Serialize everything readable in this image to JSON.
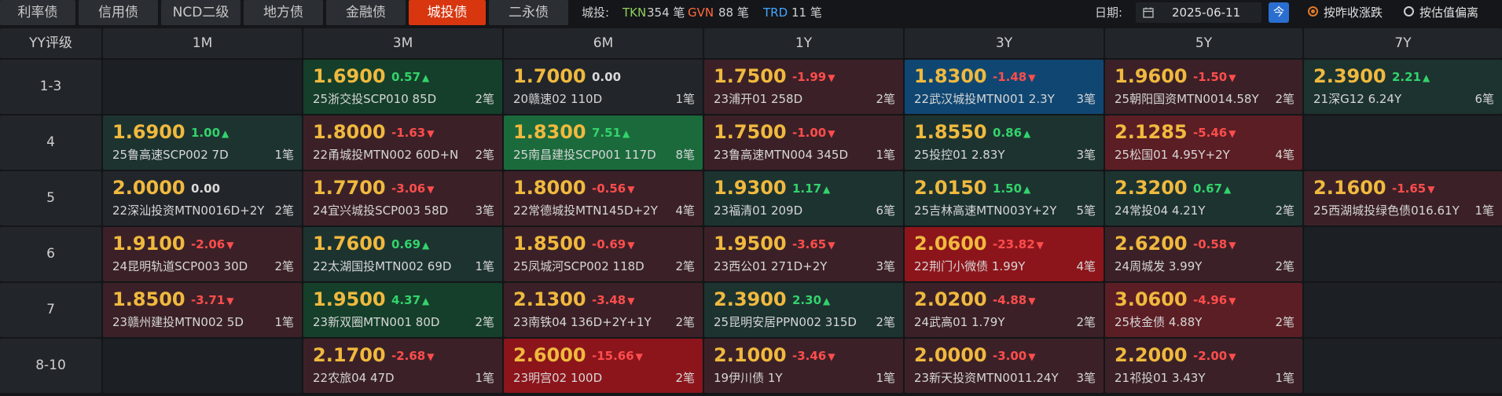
{
  "tabs": [
    {
      "label": "利率债",
      "active": false
    },
    {
      "label": "信用债",
      "active": false
    },
    {
      "label": "NCD二级",
      "active": false
    },
    {
      "label": "地方债",
      "active": false
    },
    {
      "label": "金融债",
      "active": false
    },
    {
      "label": "城投债",
      "active": true
    },
    {
      "label": "二永债",
      "active": false
    }
  ],
  "stats": {
    "category_label": "城投:",
    "tkn_label": "TKN",
    "tkn_count": "354 笔",
    "gvn_label": "GVN",
    "gvn_count": "88 笔",
    "trd_label": "TRD",
    "trd_count": "11 笔"
  },
  "date": {
    "label": "日期:",
    "value": "2025-06-11",
    "today_label": "今"
  },
  "sort": {
    "option1": "按昨收涨跌",
    "option2": "按估值偏离",
    "selected": "option1"
  },
  "colors": {
    "accent": "#d8360f",
    "rate": "#f0b93e",
    "up": "#33d36c",
    "down": "#ff4d4d",
    "tkn": "#8fd05e",
    "gvn": "#ff6a3d",
    "trd": "#46a6ff"
  },
  "grid": {
    "corner_label": "YY评级",
    "columns": [
      "1M",
      "3M",
      "6M",
      "1Y",
      "3Y",
      "5Y",
      "7Y"
    ],
    "rows": [
      {
        "label": "1-3",
        "cells": [
          null,
          {
            "rate": "1.6900",
            "change": "0.57",
            "dir": "up",
            "bond": "25浙交投SCP010 85D",
            "count": "2笔",
            "bg": "g2"
          },
          {
            "rate": "1.7000",
            "change": "0.00",
            "dir": "flat",
            "bond": "20赣速02 110D",
            "count": "1笔",
            "bg": "n"
          },
          {
            "rate": "1.7500",
            "change": "-1.99",
            "dir": "down",
            "bond": "23浦开01 258D",
            "count": "2笔",
            "bg": "r1"
          },
          {
            "rate": "1.8300",
            "change": "-1.48",
            "dir": "down",
            "bond": "22武汉城投MTN001 2.3Y",
            "count": "3笔",
            "bg": "b"
          },
          {
            "rate": "1.9600",
            "change": "-1.50",
            "dir": "down",
            "bond": "25朝阳国资MTN0014.58Y",
            "count": "2笔",
            "bg": "r1"
          },
          {
            "rate": "2.3900",
            "change": "2.21",
            "dir": "up",
            "bond": "21深G12 6.24Y",
            "count": "6笔",
            "bg": "g1"
          }
        ]
      },
      {
        "label": "4",
        "cells": [
          {
            "rate": "1.6900",
            "change": "1.00",
            "dir": "up",
            "bond": "25鲁高速SCP002 7D",
            "count": "1笔",
            "bg": "g1"
          },
          {
            "rate": "1.8000",
            "change": "-1.63",
            "dir": "down",
            "bond": "22甬城投MTN002 60D+N",
            "count": "2笔",
            "bg": "r1"
          },
          {
            "rate": "1.8300",
            "change": "7.51",
            "dir": "up",
            "bond": "25南昌建投SCP001 117D",
            "count": "8笔",
            "bg": "g3"
          },
          {
            "rate": "1.7500",
            "change": "-1.00",
            "dir": "down",
            "bond": "23鲁高速MTN004 345D",
            "count": "1笔",
            "bg": "r1"
          },
          {
            "rate": "1.8550",
            "change": "0.86",
            "dir": "up",
            "bond": "25投控01 2.83Y",
            "count": "3笔",
            "bg": "g1"
          },
          {
            "rate": "2.1285",
            "change": "-5.46",
            "dir": "down",
            "bond": "25松国01 4.95Y+2Y",
            "count": "4笔",
            "bg": "r2"
          },
          null
        ]
      },
      {
        "label": "5",
        "cells": [
          {
            "rate": "2.0000",
            "change": "0.00",
            "dir": "flat",
            "bond": "22深汕投资MTN0016D+2Y",
            "count": "2笔",
            "bg": "n"
          },
          {
            "rate": "1.7700",
            "change": "-3.06",
            "dir": "down",
            "bond": "24宜兴城投SCP003 58D",
            "count": "3笔",
            "bg": "r1"
          },
          {
            "rate": "1.8000",
            "change": "-0.56",
            "dir": "down",
            "bond": "22常德城投MTN145D+2Y",
            "count": "4笔",
            "bg": "r1"
          },
          {
            "rate": "1.9300",
            "change": "1.17",
            "dir": "up",
            "bond": "23福清01 209D",
            "count": "6笔",
            "bg": "g1"
          },
          {
            "rate": "2.0150",
            "change": "1.50",
            "dir": "up",
            "bond": "25吉林高速MTN003Y+2Y",
            "count": "5笔",
            "bg": "g1"
          },
          {
            "rate": "2.3200",
            "change": "0.67",
            "dir": "up",
            "bond": "24常投04 4.21Y",
            "count": "2笔",
            "bg": "g1"
          },
          {
            "rate": "2.1600",
            "change": "-1.65",
            "dir": "down",
            "bond": "25西湖城投绿色债016.61Y",
            "count": "1笔",
            "bg": "r1"
          }
        ]
      },
      {
        "label": "6",
        "cells": [
          {
            "rate": "1.9100",
            "change": "-2.06",
            "dir": "down",
            "bond": "24昆明轨道SCP003 30D",
            "count": "2笔",
            "bg": "r1"
          },
          {
            "rate": "1.7600",
            "change": "0.69",
            "dir": "up",
            "bond": "22太湖国投MTN002 69D",
            "count": "1笔",
            "bg": "g1"
          },
          {
            "rate": "1.8500",
            "change": "-0.69",
            "dir": "down",
            "bond": "25凤城河SCP002 118D",
            "count": "2笔",
            "bg": "r1"
          },
          {
            "rate": "1.9500",
            "change": "-3.65",
            "dir": "down",
            "bond": "23西公01 271D+2Y",
            "count": "3笔",
            "bg": "r1"
          },
          {
            "rate": "2.0600",
            "change": "-23.82",
            "dir": "down",
            "bond": "22荆门小微债 1.99Y",
            "count": "4笔",
            "bg": "r3"
          },
          {
            "rate": "2.6200",
            "change": "-0.58",
            "dir": "down",
            "bond": "24周城发 3.99Y",
            "count": "2笔",
            "bg": "r1"
          },
          null
        ]
      },
      {
        "label": "7",
        "cells": [
          {
            "rate": "1.8500",
            "change": "-3.71",
            "dir": "down",
            "bond": "23赣州建投MTN002 5D",
            "count": "1笔",
            "bg": "r1"
          },
          {
            "rate": "1.9500",
            "change": "4.37",
            "dir": "up",
            "bond": "23新双圈MTN001 80D",
            "count": "2笔",
            "bg": "g2"
          },
          {
            "rate": "2.1300",
            "change": "-3.48",
            "dir": "down",
            "bond": "23南铁04 136D+2Y+1Y",
            "count": "2笔",
            "bg": "r1"
          },
          {
            "rate": "2.3900",
            "change": "2.30",
            "dir": "up",
            "bond": "25昆明安居PPN002 315D",
            "count": "2笔",
            "bg": "g1"
          },
          {
            "rate": "2.0200",
            "change": "-4.88",
            "dir": "down",
            "bond": "24武高01 1.79Y",
            "count": "2笔",
            "bg": "r1"
          },
          {
            "rate": "3.0600",
            "change": "-4.96",
            "dir": "down",
            "bond": "25枝金债 4.88Y",
            "count": "2笔",
            "bg": "r2"
          },
          null
        ]
      },
      {
        "label": "8-10",
        "cells": [
          null,
          {
            "rate": "2.1700",
            "change": "-2.68",
            "dir": "down",
            "bond": "22农旅04 47D",
            "count": "1笔",
            "bg": "r1"
          },
          {
            "rate": "2.6000",
            "change": "-15.66",
            "dir": "down",
            "bond": "23明宫02 100D",
            "count": "2笔",
            "bg": "r3"
          },
          {
            "rate": "2.1000",
            "change": "-3.46",
            "dir": "down",
            "bond": "19伊川债 1Y",
            "count": "1笔",
            "bg": "r1"
          },
          {
            "rate": "2.0000",
            "change": "-3.00",
            "dir": "down",
            "bond": "23新天投资MTN0011.24Y",
            "count": "3笔",
            "bg": "r1"
          },
          {
            "rate": "2.2000",
            "change": "-2.00",
            "dir": "down",
            "bond": "21祁投01 3.43Y",
            "count": "1笔",
            "bg": "r1"
          },
          null
        ]
      }
    ]
  }
}
